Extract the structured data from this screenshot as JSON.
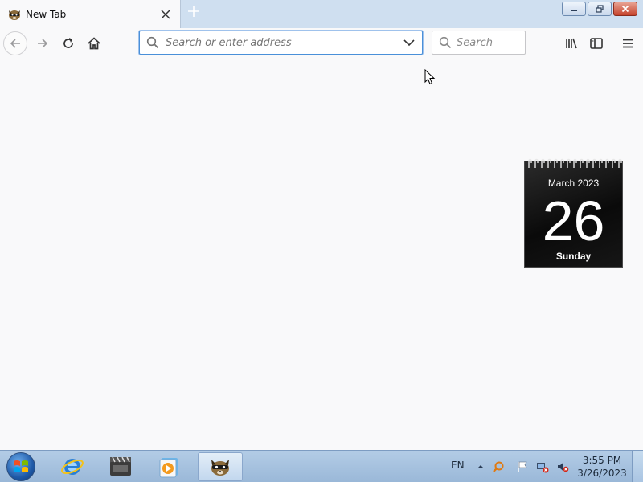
{
  "browser": {
    "tab": {
      "title": "New Tab",
      "favicon": "raccoon-icon"
    },
    "urlbar": {
      "placeholder": "Search or enter address",
      "value": ""
    },
    "searchbar": {
      "placeholder": "Search"
    },
    "nav_icons": [
      "back-arrow-icon",
      "forward-arrow-icon",
      "reload-icon",
      "home-icon"
    ],
    "toolbar_icons": [
      "library-icon",
      "sidebar-icon",
      "hamburger-menu-icon"
    ]
  },
  "calendar_gadget": {
    "month_year": "March 2023",
    "day": "26",
    "weekday": "Sunday"
  },
  "taskbar": {
    "items": [
      "internet-explorer-icon",
      "video-clapper-icon",
      "media-player-icon",
      "raccoon-browser-icon"
    ],
    "active_item": "raccoon-browser-icon",
    "language": "EN",
    "clock": {
      "time": "3:55 PM",
      "date": "3/26/2023"
    }
  },
  "colors": {
    "accent": "#4a90d9",
    "tabstrip": "#cfdff0",
    "taskbar": "#9ab8d8"
  }
}
